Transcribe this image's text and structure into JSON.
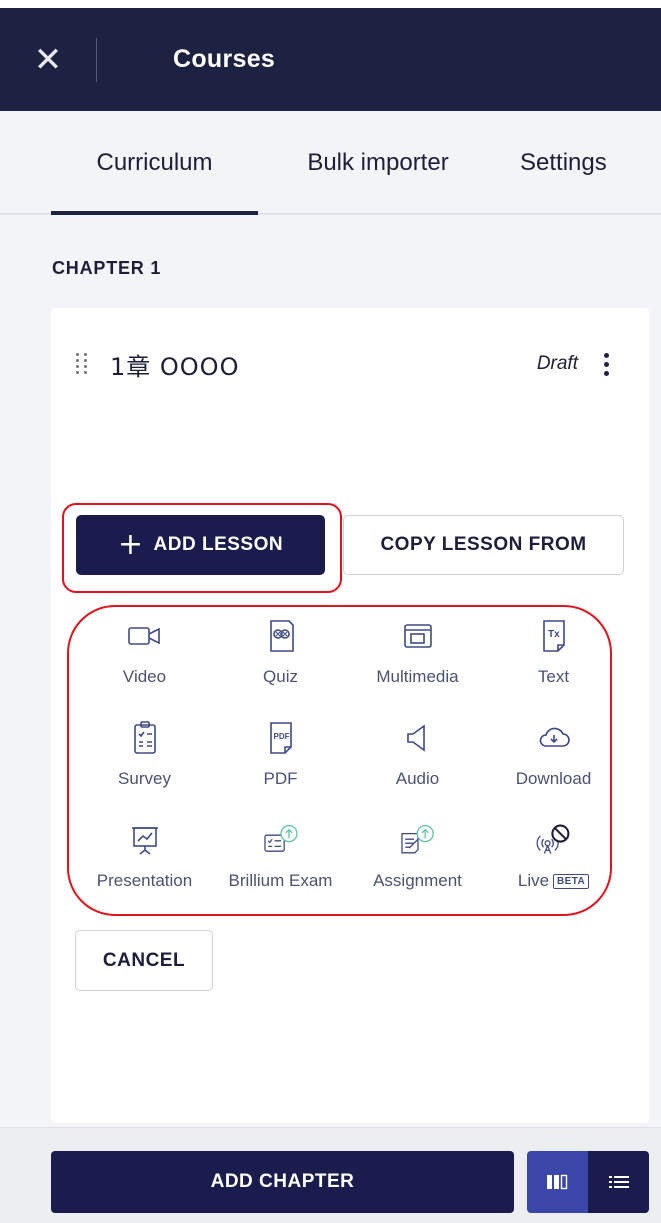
{
  "header": {
    "title": "Courses",
    "close_glyph": "✕"
  },
  "tabs": [
    {
      "label": "Curriculum",
      "active": true
    },
    {
      "label": "Bulk importer",
      "active": false
    },
    {
      "label": "Settings",
      "active": false
    }
  ],
  "chapter": {
    "label": "CHAPTER 1",
    "lesson": {
      "title": "1章 OOOO",
      "status": "Draft"
    }
  },
  "actions": {
    "add_lesson_label": "ADD LESSON",
    "add_lesson_icon": "+",
    "copy_lesson_label": "COPY LESSON FROM",
    "cancel_label": "CANCEL"
  },
  "lesson_types": [
    {
      "label": "Video",
      "icon": "video-icon"
    },
    {
      "label": "Quiz",
      "icon": "quiz-icon"
    },
    {
      "label": "Multimedia",
      "icon": "multimedia-icon"
    },
    {
      "label": "Text",
      "icon": "text-icon"
    },
    {
      "label": "Survey",
      "icon": "survey-icon"
    },
    {
      "label": "PDF",
      "icon": "pdf-icon"
    },
    {
      "label": "Audio",
      "icon": "audio-icon"
    },
    {
      "label": "Download",
      "icon": "download-icon"
    },
    {
      "label": "Presentation",
      "icon": "presentation-icon"
    },
    {
      "label": "Brillium Exam",
      "icon": "brillium-exam-icon"
    },
    {
      "label": "Assignment",
      "icon": "assignment-icon"
    },
    {
      "label": "Live",
      "icon": "live-icon",
      "badge": "BETA"
    }
  ],
  "footer": {
    "add_chapter_label": "ADD CHAPTER",
    "view_mode": "columns"
  },
  "colors": {
    "navy": "#1e2242",
    "button_navy": "#1a1c4d",
    "active_toggle": "#3a47a8",
    "icon": "#3e4a87",
    "upload_badge": "#5cc3a6",
    "highlight": "#e3121c"
  }
}
